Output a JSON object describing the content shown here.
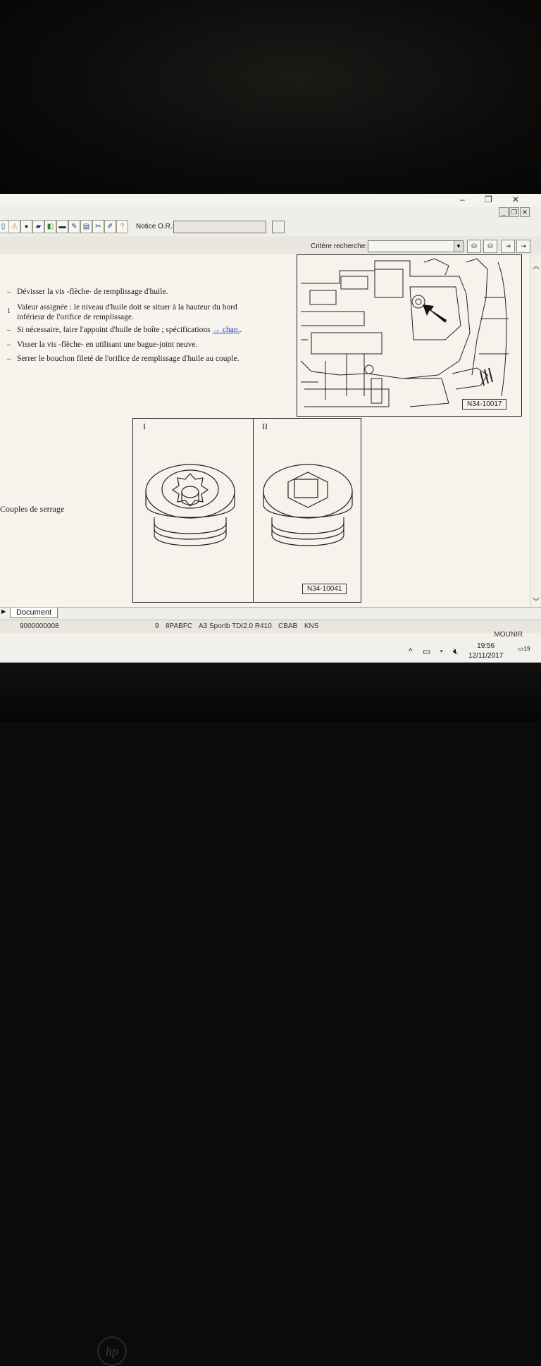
{
  "toolbar": {
    "notice_label": "Notice O.R.:"
  },
  "search": {
    "label": "Critère recherche:"
  },
  "steps": [
    "Dévisser la vis -flèche- de remplissage d'huile.",
    "Valeur assignée : le niveau d'huile doit se situer à la hauteur du bord",
    "inférieur de l'orifice de remplissage.",
    "Si nécessaire, faire l'appoint d'huile de boîte ; spécifications",
    "Visser la vis -flèche- en utilisant une bague-joint neuve.",
    "Serrer le bouchon fileté de l'orifice de remplissage d'huile au couple."
  ],
  "step_number": "1",
  "chap_link": "→ chap.",
  "period": ".",
  "torque_label": "Couples de serrage",
  "figure1": {
    "code": "N34-10017"
  },
  "figure2": {
    "code": "N34-10041",
    "panel1": "I",
    "panel2": "II"
  },
  "tab": {
    "label": "Document"
  },
  "status": {
    "id": "9000000008",
    "n": "9",
    "code": "8PABFC",
    "model": "A3 Sportb TDI2.0 R410",
    "engine": "CBAB",
    "gear": "KNS"
  },
  "user": "MOUNIR",
  "clock": {
    "time": "19:56",
    "date": "12/11/2017"
  },
  "notifications": "19",
  "brand": "hp"
}
